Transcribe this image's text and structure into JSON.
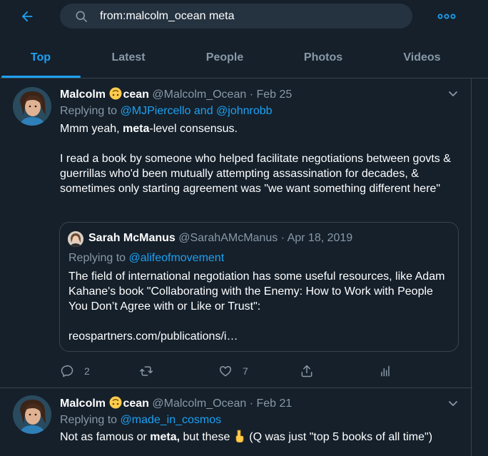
{
  "search": {
    "query": "from:malcolm_ocean meta"
  },
  "tabs": [
    {
      "label": "Top"
    },
    {
      "label": "Latest"
    },
    {
      "label": "People"
    },
    {
      "label": "Photos"
    },
    {
      "label": "Videos"
    }
  ],
  "colors": {
    "background": "#15202b",
    "accent": "#1da1f2",
    "muted": "#8899a6",
    "border": "#38444d"
  },
  "tweets": [
    {
      "name_a": "Malcolm",
      "name_b": "cean",
      "name_emoji": "upside-down-face-emoji",
      "handle": "@Malcolm_Ocean",
      "separator": "·",
      "date": "Feb 25",
      "replying_prefix": "Replying to",
      "reply_user_1": "@MJPiercello",
      "reply_and": "and",
      "reply_user_2": "@johnrobb",
      "p1_before": "Mmm yeah, ",
      "p1_bold": "meta",
      "p1_after": "-level consensus.",
      "p2": "I read a book by someone who helped facilitate negotiations between govts & guerrillas who'd been mutually attempting assassination for decades, & sometimes only starting agreement was \"we want something different here\"",
      "quote": {
        "name": "Sarah McManus",
        "handle": "@SarahAMcManus",
        "separator": "·",
        "date": "Apr 18, 2019",
        "replying_prefix": "Replying to",
        "reply_user": "@alifeofmovement",
        "text": "The field of international negotiation has some useful resources, like Adam Kahane's book \"Collaborating with the Enemy: How to Work with People You Don’t Agree with or Like or Trust\":",
        "link": "reospartners.com/publications/i…"
      },
      "reply_count": "2",
      "retweet_count": "",
      "like_count": "7"
    },
    {
      "name_a": "Malcolm",
      "name_b": "cean",
      "name_emoji": "upside-down-face-emoji",
      "handle": "@Malcolm_Ocean",
      "separator": "·",
      "date": "Feb 21",
      "replying_prefix": "Replying to",
      "reply_user_1": "@made_in_cosmos",
      "t_before": "Not as famous or ",
      "t_bold": "meta,",
      "t_middle": " but these ",
      "t_emoji": "pointing-down-emoji",
      "t_after": " (Q was just \"top 5 books of all time\")"
    }
  ]
}
